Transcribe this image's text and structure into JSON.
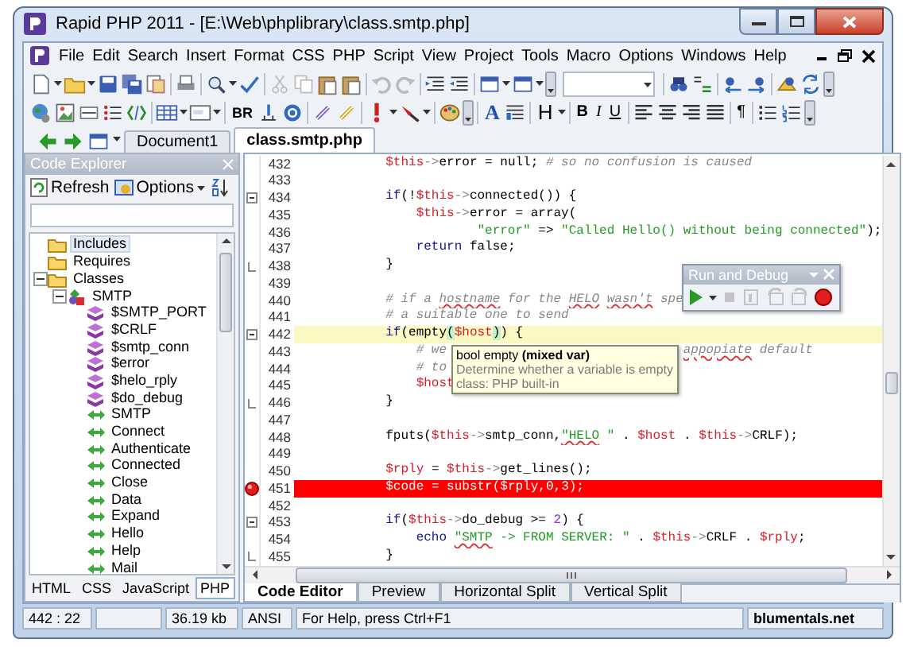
{
  "window": {
    "title": "Rapid PHP 2011 - [E:\\Web\\phplibrary\\class.smtp.php]"
  },
  "menu": [
    "File",
    "Edit",
    "Search",
    "Insert",
    "Format",
    "CSS",
    "PHP",
    "Script",
    "View",
    "Project",
    "Tools",
    "Macro",
    "Options",
    "Windows",
    "Help"
  ],
  "format_toolbar": {
    "buttons": [
      "BR",
      "A",
      "H",
      "B",
      "I",
      "U",
      "¶"
    ]
  },
  "document_tabs": [
    {
      "label": "Document1",
      "selected": false
    },
    {
      "label": "class.smtp.php",
      "selected": true
    }
  ],
  "code_explorer": {
    "title": "Code Explorer",
    "refresh": "Refresh",
    "options": "Options",
    "tree": [
      {
        "label": "Includes",
        "kind": "folder",
        "selected": true
      },
      {
        "label": "Requires",
        "kind": "folder",
        "selected": false
      },
      {
        "label": "Classes",
        "kind": "folder",
        "selected": false,
        "expanded": true,
        "children": [
          {
            "label": "SMTP",
            "kind": "class",
            "selected": false,
            "expanded": true,
            "children": [
              {
                "label": "$SMTP_PORT",
                "kind": "property",
                "selected": false
              },
              {
                "label": "$CRLF",
                "kind": "property",
                "selected": false
              },
              {
                "label": "$smtp_conn",
                "kind": "property",
                "selected": false
              },
              {
                "label": "$error",
                "kind": "property",
                "selected": false
              },
              {
                "label": "$helo_rply",
                "kind": "property",
                "selected": false
              },
              {
                "label": "$do_debug",
                "kind": "property",
                "selected": false
              },
              {
                "label": "SMTP",
                "kind": "method",
                "selected": false
              },
              {
                "label": "Connect",
                "kind": "method",
                "selected": false
              },
              {
                "label": "Authenticate",
                "kind": "method",
                "selected": false
              },
              {
                "label": "Connected",
                "kind": "method",
                "selected": false
              },
              {
                "label": "Close",
                "kind": "method",
                "selected": false
              },
              {
                "label": "Data",
                "kind": "method",
                "selected": false
              },
              {
                "label": "Expand",
                "kind": "method",
                "selected": false
              },
              {
                "label": "Hello",
                "kind": "method",
                "selected": false
              },
              {
                "label": "Help",
                "kind": "method",
                "selected": false
              },
              {
                "label": "Mail",
                "kind": "method",
                "selected": false
              }
            ]
          }
        ]
      }
    ],
    "tabs": [
      {
        "label": "HTML",
        "selected": false
      },
      {
        "label": "CSS",
        "selected": false
      },
      {
        "label": "JavaScript",
        "selected": false
      },
      {
        "label": "PHP",
        "selected": true
      }
    ]
  },
  "editor": {
    "lines": [
      {
        "number": "432",
        "kind": "plain",
        "current": false,
        "breakpoint": false,
        "tokens": [
          {
            "kind": "var",
            "text": "            $this"
          },
          {
            "kind": "op",
            "text": "->"
          },
          {
            "kind": "plain",
            "text": "error = null; "
          },
          {
            "kind": "comment",
            "text": "# so no confusion is caused"
          }
        ]
      },
      {
        "number": "433",
        "kind": "plain",
        "current": false,
        "breakpoint": false
      },
      {
        "number": "434",
        "kind": "fold-start",
        "current": false,
        "breakpoint": false,
        "tokens": [
          {
            "kind": "keyword",
            "text": "            if"
          },
          {
            "kind": "plain",
            "text": "(!"
          },
          {
            "kind": "var",
            "text": "$this"
          },
          {
            "kind": "op",
            "text": "->"
          },
          {
            "kind": "plain",
            "text": "connected()) {"
          }
        ]
      },
      {
        "number": "435",
        "kind": "plain",
        "current": false,
        "breakpoint": false,
        "tokens": [
          {
            "kind": "var",
            "text": "                $this"
          },
          {
            "kind": "op",
            "text": "->"
          },
          {
            "kind": "plain",
            "text": "error = array("
          }
        ]
      },
      {
        "number": "436",
        "kind": "plain",
        "current": false,
        "breakpoint": false,
        "tokens": [
          {
            "kind": "string",
            "text": "                        \"error\""
          },
          {
            "kind": "plain",
            "text": " => "
          },
          {
            "kind": "string",
            "text": "\"Called Hello() without being connected\""
          },
          {
            "kind": "plain",
            "text": ");"
          }
        ]
      },
      {
        "number": "437",
        "kind": "plain",
        "current": false,
        "breakpoint": false,
        "tokens": [
          {
            "kind": "keyword",
            "text": "                return"
          },
          {
            "kind": "plain",
            "text": " false;"
          }
        ]
      },
      {
        "number": "438",
        "kind": "fold-end",
        "current": false,
        "breakpoint": false,
        "tokens": [
          {
            "kind": "plain",
            "text": "            }"
          }
        ]
      },
      {
        "number": "439",
        "kind": "plain",
        "current": false,
        "breakpoint": false
      },
      {
        "number": "440",
        "kind": "plain",
        "current": false,
        "breakpoint": false,
        "tokens": [
          {
            "kind": "comment",
            "text": "            # if a "
          },
          {
            "kind": "misspelled-comment",
            "text": "hostname"
          },
          {
            "kind": "comment",
            "text": " for the "
          },
          {
            "kind": "misspelled-comment",
            "text": "HELO"
          },
          {
            "kind": "misspelled-comment",
            "text": " wasn't"
          },
          {
            "kind": "comment",
            "text": " spe"
          }
        ]
      },
      {
        "number": "441",
        "kind": "plain",
        "current": false,
        "breakpoint": false,
        "tokens": [
          {
            "kind": "comment",
            "text": "            # a suitable one to send"
          }
        ]
      },
      {
        "number": "442",
        "kind": "fold-start",
        "current": true,
        "breakpoint": false,
        "tokens": [
          {
            "kind": "keyword",
            "text": "            if"
          },
          {
            "kind": "plain",
            "text": "(empty"
          },
          {
            "kind": "brace",
            "text": "("
          },
          {
            "kind": "var",
            "text": "$host"
          },
          {
            "kind": "brace",
            "text": ")"
          },
          {
            "kind": "plain",
            "text": ") {"
          }
        ]
      },
      {
        "number": "443",
        "kind": "plain",
        "current": false,
        "breakpoint": false,
        "tokens": [
          {
            "kind": "comment",
            "text": "                # we"
          },
          {
            "kind": "misspelled-comment",
            "text": "                               appopiate"
          },
          {
            "kind": "comment",
            "text": " default"
          }
        ]
      },
      {
        "number": "444",
        "kind": "plain",
        "current": false,
        "breakpoint": false,
        "tokens": [
          {
            "kind": "comment",
            "text": "                # to"
          }
        ]
      },
      {
        "number": "445",
        "kind": "plain",
        "current": false,
        "breakpoint": false,
        "tokens": [
          {
            "kind": "var",
            "text": "                $host"
          }
        ]
      },
      {
        "number": "446",
        "kind": "fold-end",
        "current": false,
        "breakpoint": false,
        "tokens": [
          {
            "kind": "plain",
            "text": "            }"
          }
        ]
      },
      {
        "number": "447",
        "kind": "plain",
        "current": false,
        "breakpoint": false
      },
      {
        "number": "448",
        "kind": "plain",
        "current": false,
        "breakpoint": false,
        "tokens": [
          {
            "kind": "plain",
            "text": "            fputs("
          },
          {
            "kind": "var",
            "text": "$this"
          },
          {
            "kind": "op",
            "text": "->"
          },
          {
            "kind": "plain",
            "text": "smtp_conn,"
          },
          {
            "kind": "misspelled-string",
            "text": "\"HELO"
          },
          {
            "kind": "string",
            "text": " \""
          },
          {
            "kind": "plain",
            "text": " . "
          },
          {
            "kind": "var",
            "text": "$host"
          },
          {
            "kind": "plain",
            "text": " . "
          },
          {
            "kind": "var",
            "text": "$this"
          },
          {
            "kind": "op",
            "text": "->"
          },
          {
            "kind": "plain",
            "text": "CRLF);"
          }
        ]
      },
      {
        "number": "449",
        "kind": "plain",
        "current": false,
        "breakpoint": false
      },
      {
        "number": "450",
        "kind": "plain",
        "current": false,
        "breakpoint": false,
        "tokens": [
          {
            "kind": "var",
            "text": "            $rply"
          },
          {
            "kind": "plain",
            "text": " = "
          },
          {
            "kind": "var",
            "text": "$this"
          },
          {
            "kind": "op",
            "text": "->"
          },
          {
            "kind": "plain",
            "text": "get_lines();"
          }
        ]
      },
      {
        "number": "451",
        "kind": "plain",
        "current": false,
        "breakpoint": true,
        "tokens": [
          {
            "kind": "var",
            "text": "            $code"
          },
          {
            "kind": "plain",
            "text": " = substr("
          },
          {
            "kind": "var",
            "text": "$rply"
          },
          {
            "kind": "plain",
            "text": ",0,3);"
          }
        ]
      },
      {
        "number": "452",
        "kind": "plain",
        "current": false,
        "breakpoint": false
      },
      {
        "number": "453",
        "kind": "fold-start",
        "current": false,
        "breakpoint": false,
        "tokens": [
          {
            "kind": "keyword",
            "text": "            if"
          },
          {
            "kind": "plain",
            "text": "("
          },
          {
            "kind": "var",
            "text": "$this"
          },
          {
            "kind": "op",
            "text": "->"
          },
          {
            "kind": "plain",
            "text": "do_debug >= "
          },
          {
            "kind": "number",
            "text": "2"
          },
          {
            "kind": "plain",
            "text": ") {"
          }
        ]
      },
      {
        "number": "454",
        "kind": "plain",
        "current": false,
        "breakpoint": false,
        "tokens": [
          {
            "kind": "keyword",
            "text": "                echo"
          },
          {
            "kind": "misspelled-string",
            "text": " \"SMTP"
          },
          {
            "kind": "string",
            "text": " -> FROM SERVER: \""
          },
          {
            "kind": "plain",
            "text": " . "
          },
          {
            "kind": "var",
            "text": "$this"
          },
          {
            "kind": "op",
            "text": "->"
          },
          {
            "kind": "plain",
            "text": "CRLF . "
          },
          {
            "kind": "var",
            "text": "$rply"
          },
          {
            "kind": "plain",
            "text": ";"
          }
        ]
      },
      {
        "number": "455",
        "kind": "fold-end",
        "current": false,
        "breakpoint": false,
        "tokens": [
          {
            "kind": "plain",
            "text": "            }"
          }
        ]
      }
    ],
    "tooltip": {
      "signature": "bool empty **(mixed var)**",
      "description": "Determine whether a variable is empty",
      "origin": "class: PHP built-in"
    },
    "run_panel": {
      "title": "Run and Debug"
    },
    "view_tabs": [
      {
        "label": "Code Editor",
        "selected": true
      },
      {
        "label": "Preview",
        "selected": false
      },
      {
        "label": "Horizontal Split",
        "selected": false
      },
      {
        "label": "Vertical Split",
        "selected": false
      }
    ]
  },
  "status_bar": {
    "position": "442 : 22",
    "file_size": "36.19 kb",
    "encoding": "ANSI",
    "hint": "For Help, press Ctrl+F1",
    "website": "blumentals.net"
  }
}
